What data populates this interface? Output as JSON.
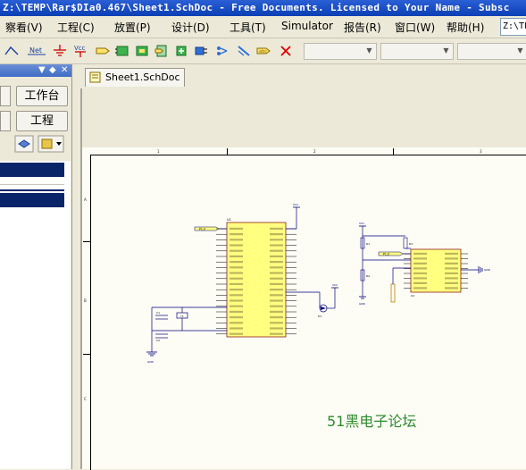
{
  "window": {
    "title": "Z:\\TEMP\\Rar$DIa0.467\\Sheet1.SchDoc - Free Documents. Licensed to Your Name - Subsc"
  },
  "menu": {
    "items": [
      "察看(V)",
      "工程(C)",
      "放置(P)",
      "设计(D)",
      "工具(T)",
      "Simulator",
      "报告(R)",
      "窗口(W)",
      "帮助(H)"
    ],
    "path_field": "Z:\\TE"
  },
  "toolbar": {
    "icons": [
      "wire-icon",
      "net-label-icon",
      "ground-icon",
      "vcc-icon",
      "port-icon",
      "part-icon",
      "sheet-symbol-icon",
      "sheet-entry-icon",
      "add-part-icon",
      "harness-icon",
      "directive-icon",
      "no-erc-icon"
    ],
    "net_label_text": "Net",
    "vcc_text": "Vcc"
  },
  "left_panel": {
    "buttons": [
      "工作台",
      "工程"
    ]
  },
  "document_tab": {
    "label": "Sheet1.SchDoc"
  },
  "sheet": {
    "column_markers": [
      "1",
      "2",
      "3"
    ],
    "row_markers": [
      "A",
      "B",
      "C"
    ],
    "net_labels": [
      "P1.0",
      "P1.0",
      "VCC",
      "VCC",
      "VCC",
      "GND",
      "GND",
      "GND"
    ],
    "components": {
      "mcu": "U1",
      "driver": "U2",
      "crystal": "Y1",
      "cap1": "C1",
      "cap2": "C2",
      "r1": "R1",
      "r2": "R2",
      "r3": "R3",
      "led": "D1"
    },
    "watermark": "51黑电子论坛"
  },
  "colors": {
    "title_bar": "#0b3fb4",
    "chip_fill": "#ffff80",
    "wire": "#000080",
    "sheet_bg": "#fdfdf5",
    "net_label_fill": "#ffff80",
    "watermark": "#2e8a2e",
    "selection": "#0a246a"
  }
}
